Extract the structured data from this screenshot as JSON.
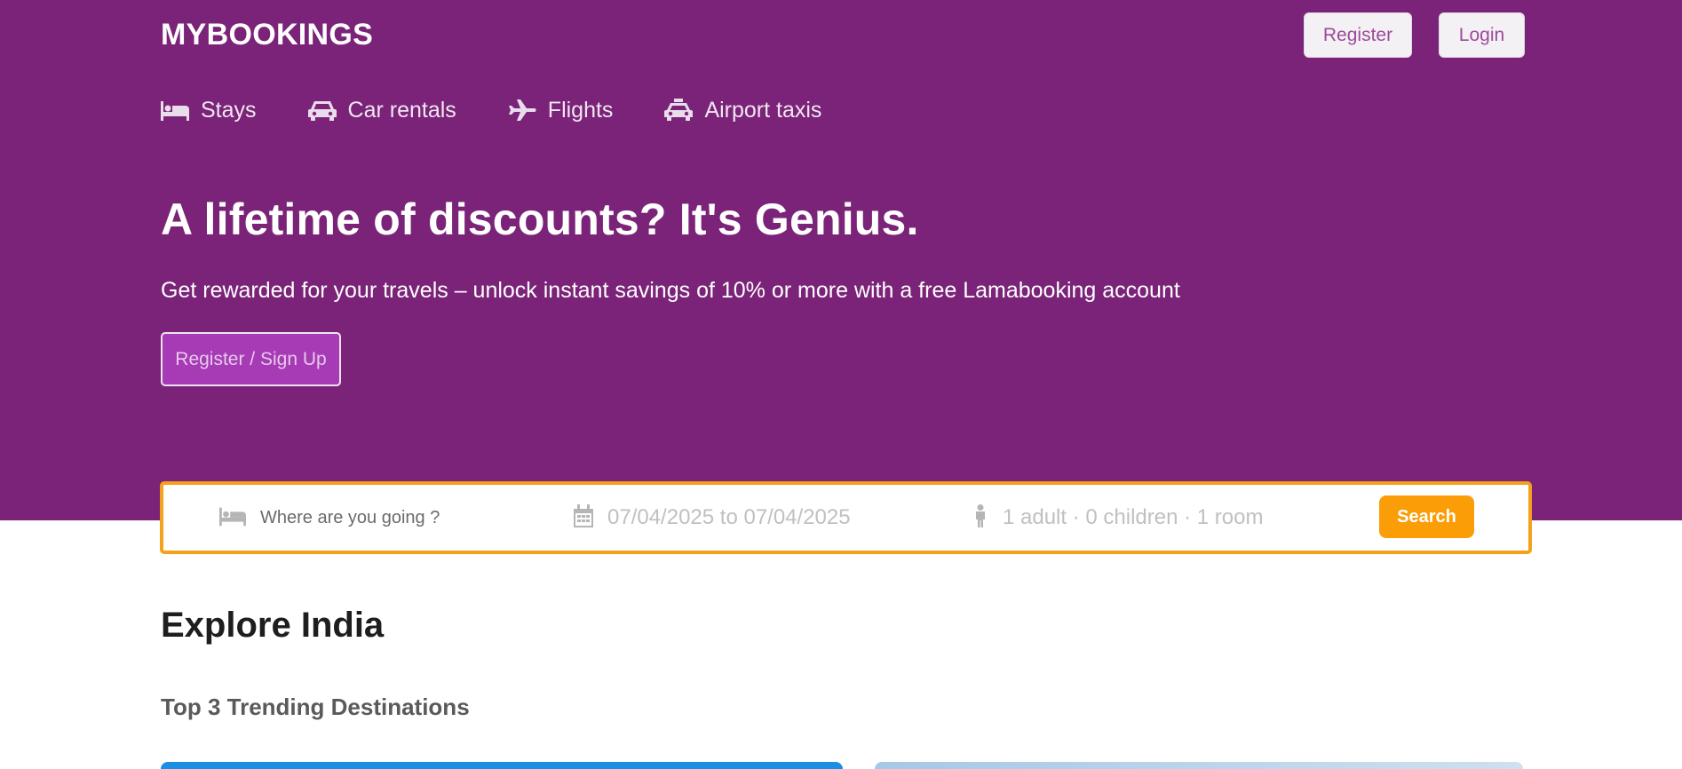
{
  "header": {
    "logo": "MYBOOKINGS",
    "register_label": "Register",
    "login_label": "Login"
  },
  "nav": {
    "tabs": [
      {
        "label": "Stays",
        "icon": "bed-icon"
      },
      {
        "label": "Car rentals",
        "icon": "car-icon"
      },
      {
        "label": "Flights",
        "icon": "plane-icon"
      },
      {
        "label": "Airport taxis",
        "icon": "taxi-icon"
      }
    ]
  },
  "hero": {
    "headline": "A lifetime of discounts? It's Genius.",
    "subline": "Get rewarded for your travels – unlock instant savings of 10% or more with a free Lamabooking account",
    "signup_label": "Register / Sign Up"
  },
  "search": {
    "destination_placeholder": "Where are you going ?",
    "dates": "07/04/2025 to 07/04/2025",
    "guests": "1 adult · 0 children · 1 room",
    "button_label": "Search"
  },
  "main": {
    "section_title": "Explore India",
    "subsection_title": "Top 3 Trending Destinations"
  },
  "colors": {
    "hero_bg": "#7a2378",
    "accent": "#fb9d06",
    "signup_bg": "#a63bb5"
  }
}
